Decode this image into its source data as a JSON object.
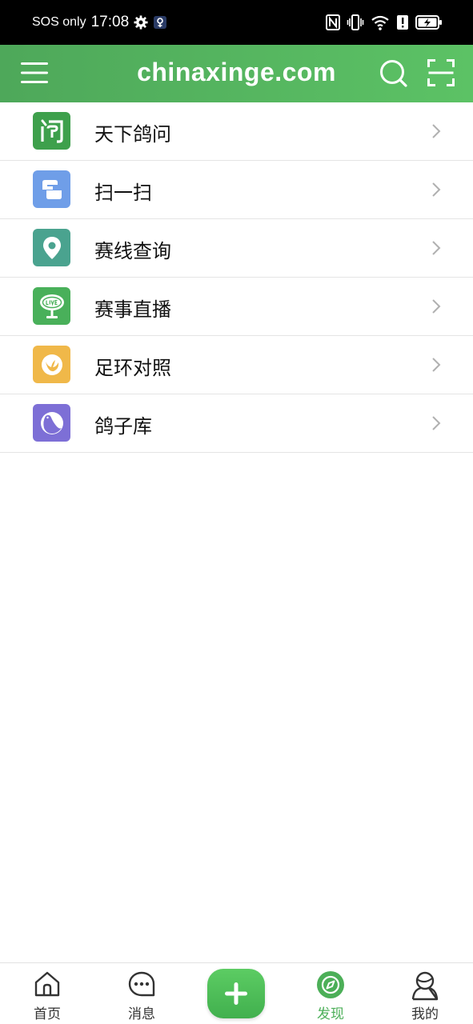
{
  "status_bar": {
    "carrier": "SOS only",
    "time": "17:08",
    "icons": [
      "gear-icon",
      "location-badge-icon",
      "nfc-icon",
      "vibrate-icon",
      "wifi-icon",
      "alert-icon",
      "battery-charging-icon"
    ]
  },
  "app_bar": {
    "title": "chinaxinge.com",
    "icons": [
      "menu-icon",
      "search-icon",
      "scan-icon"
    ],
    "gradient": [
      "#4ea85a",
      "#5cc265"
    ]
  },
  "menu_items": [
    {
      "label": "天下鸽问",
      "icon": "question-icon",
      "color": "#3ea04c"
    },
    {
      "label": "扫一扫",
      "icon": "scan-frame-icon",
      "color": "#6f9ee8"
    },
    {
      "label": "赛线查询",
      "icon": "location-pin-icon",
      "color": "#4aa38f"
    },
    {
      "label": "赛事直播",
      "icon": "live-icon",
      "color": "#49b05a"
    },
    {
      "label": "足环对照",
      "icon": "ring-icon",
      "color": "#f0b849"
    },
    {
      "label": "鸽子库",
      "icon": "pigeon-icon",
      "color": "#7d6fd6"
    }
  ],
  "tab_bar": {
    "tabs": [
      {
        "label": "首页",
        "icon": "home-icon"
      },
      {
        "label": "消息",
        "icon": "message-icon"
      },
      {
        "label": "",
        "icon": "plus-icon"
      },
      {
        "label": "发现",
        "icon": "compass-icon",
        "active": true
      },
      {
        "label": "我的",
        "icon": "user-icon"
      }
    ],
    "active_color": "#4caf58"
  }
}
